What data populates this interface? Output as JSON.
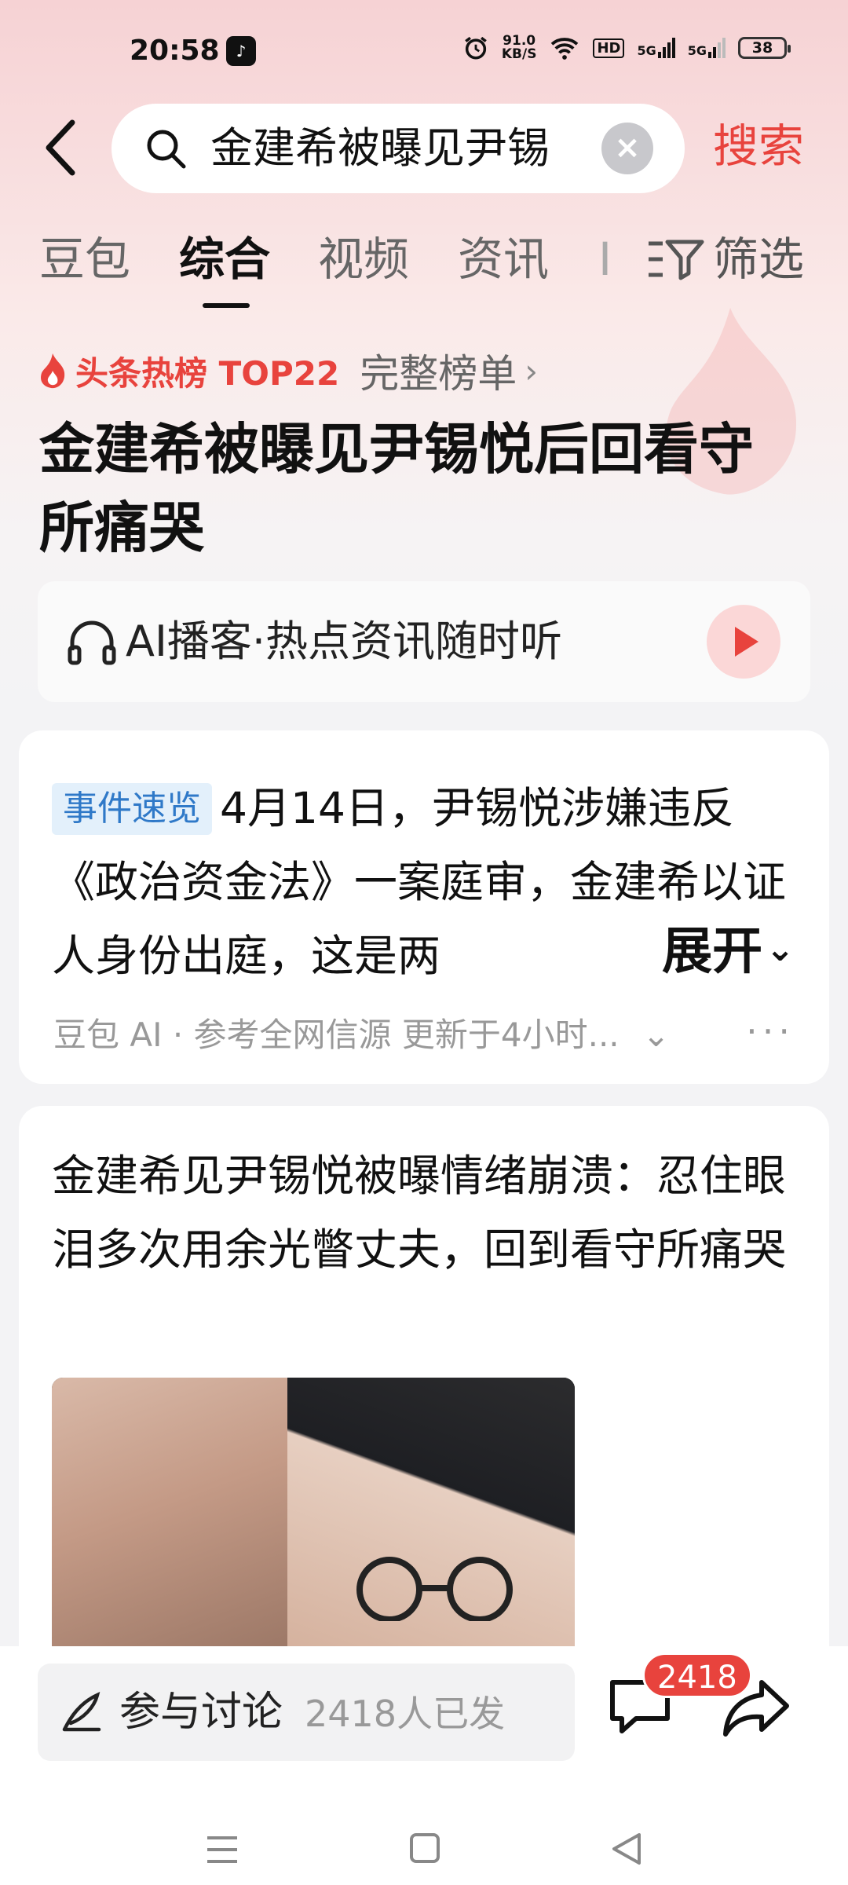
{
  "status_bar": {
    "time": "20:58",
    "app_icon": "douyin-icon",
    "speed_value": "91.0",
    "speed_unit": "KB/S",
    "hd_label": "HD",
    "net1": "5G",
    "net2": "5G",
    "battery": "38"
  },
  "search": {
    "query": "金建希被曝见尹锡",
    "clear_icon": "×",
    "button_label": "搜索"
  },
  "tabs": {
    "items": [
      "豆包",
      "综合",
      "视频",
      "资讯",
      "I"
    ],
    "active": "综合",
    "filter_label": "筛选"
  },
  "hot_list": {
    "title": "头条热榜 TOP22",
    "full_list_label": "完整榜单",
    "chevron": "›",
    "headline": "金建希被曝见尹锡悦后回看守所痛哭"
  },
  "podcast": {
    "label": "AI播客·热点资讯随时听"
  },
  "summary_card": {
    "badge": "事件速览",
    "text": "4月14日，尹锡悦涉嫌违反《政治资金法》一案庭审，金建希以证人身份出庭，这是两",
    "expand_label": "展开",
    "expand_icon": "⌄",
    "meta": "豆包 AI · 参考全网信源 更新于4小时...",
    "meta_chevron": "⌄",
    "more_icon": "···"
  },
  "article_card": {
    "title": "金建希见尹锡悦被曝情绪崩溃：忍住眼泪多次用余光瞥丈夫，回到看守所痛哭"
  },
  "bottom_bar": {
    "discuss_label": "参与讨论",
    "discuss_count": "2418人已发",
    "comment_count": "2418"
  },
  "colors": {
    "accent": "#e8433d",
    "badge_blue": "#2f79c8",
    "badge_bg": "#e3f0fb"
  }
}
